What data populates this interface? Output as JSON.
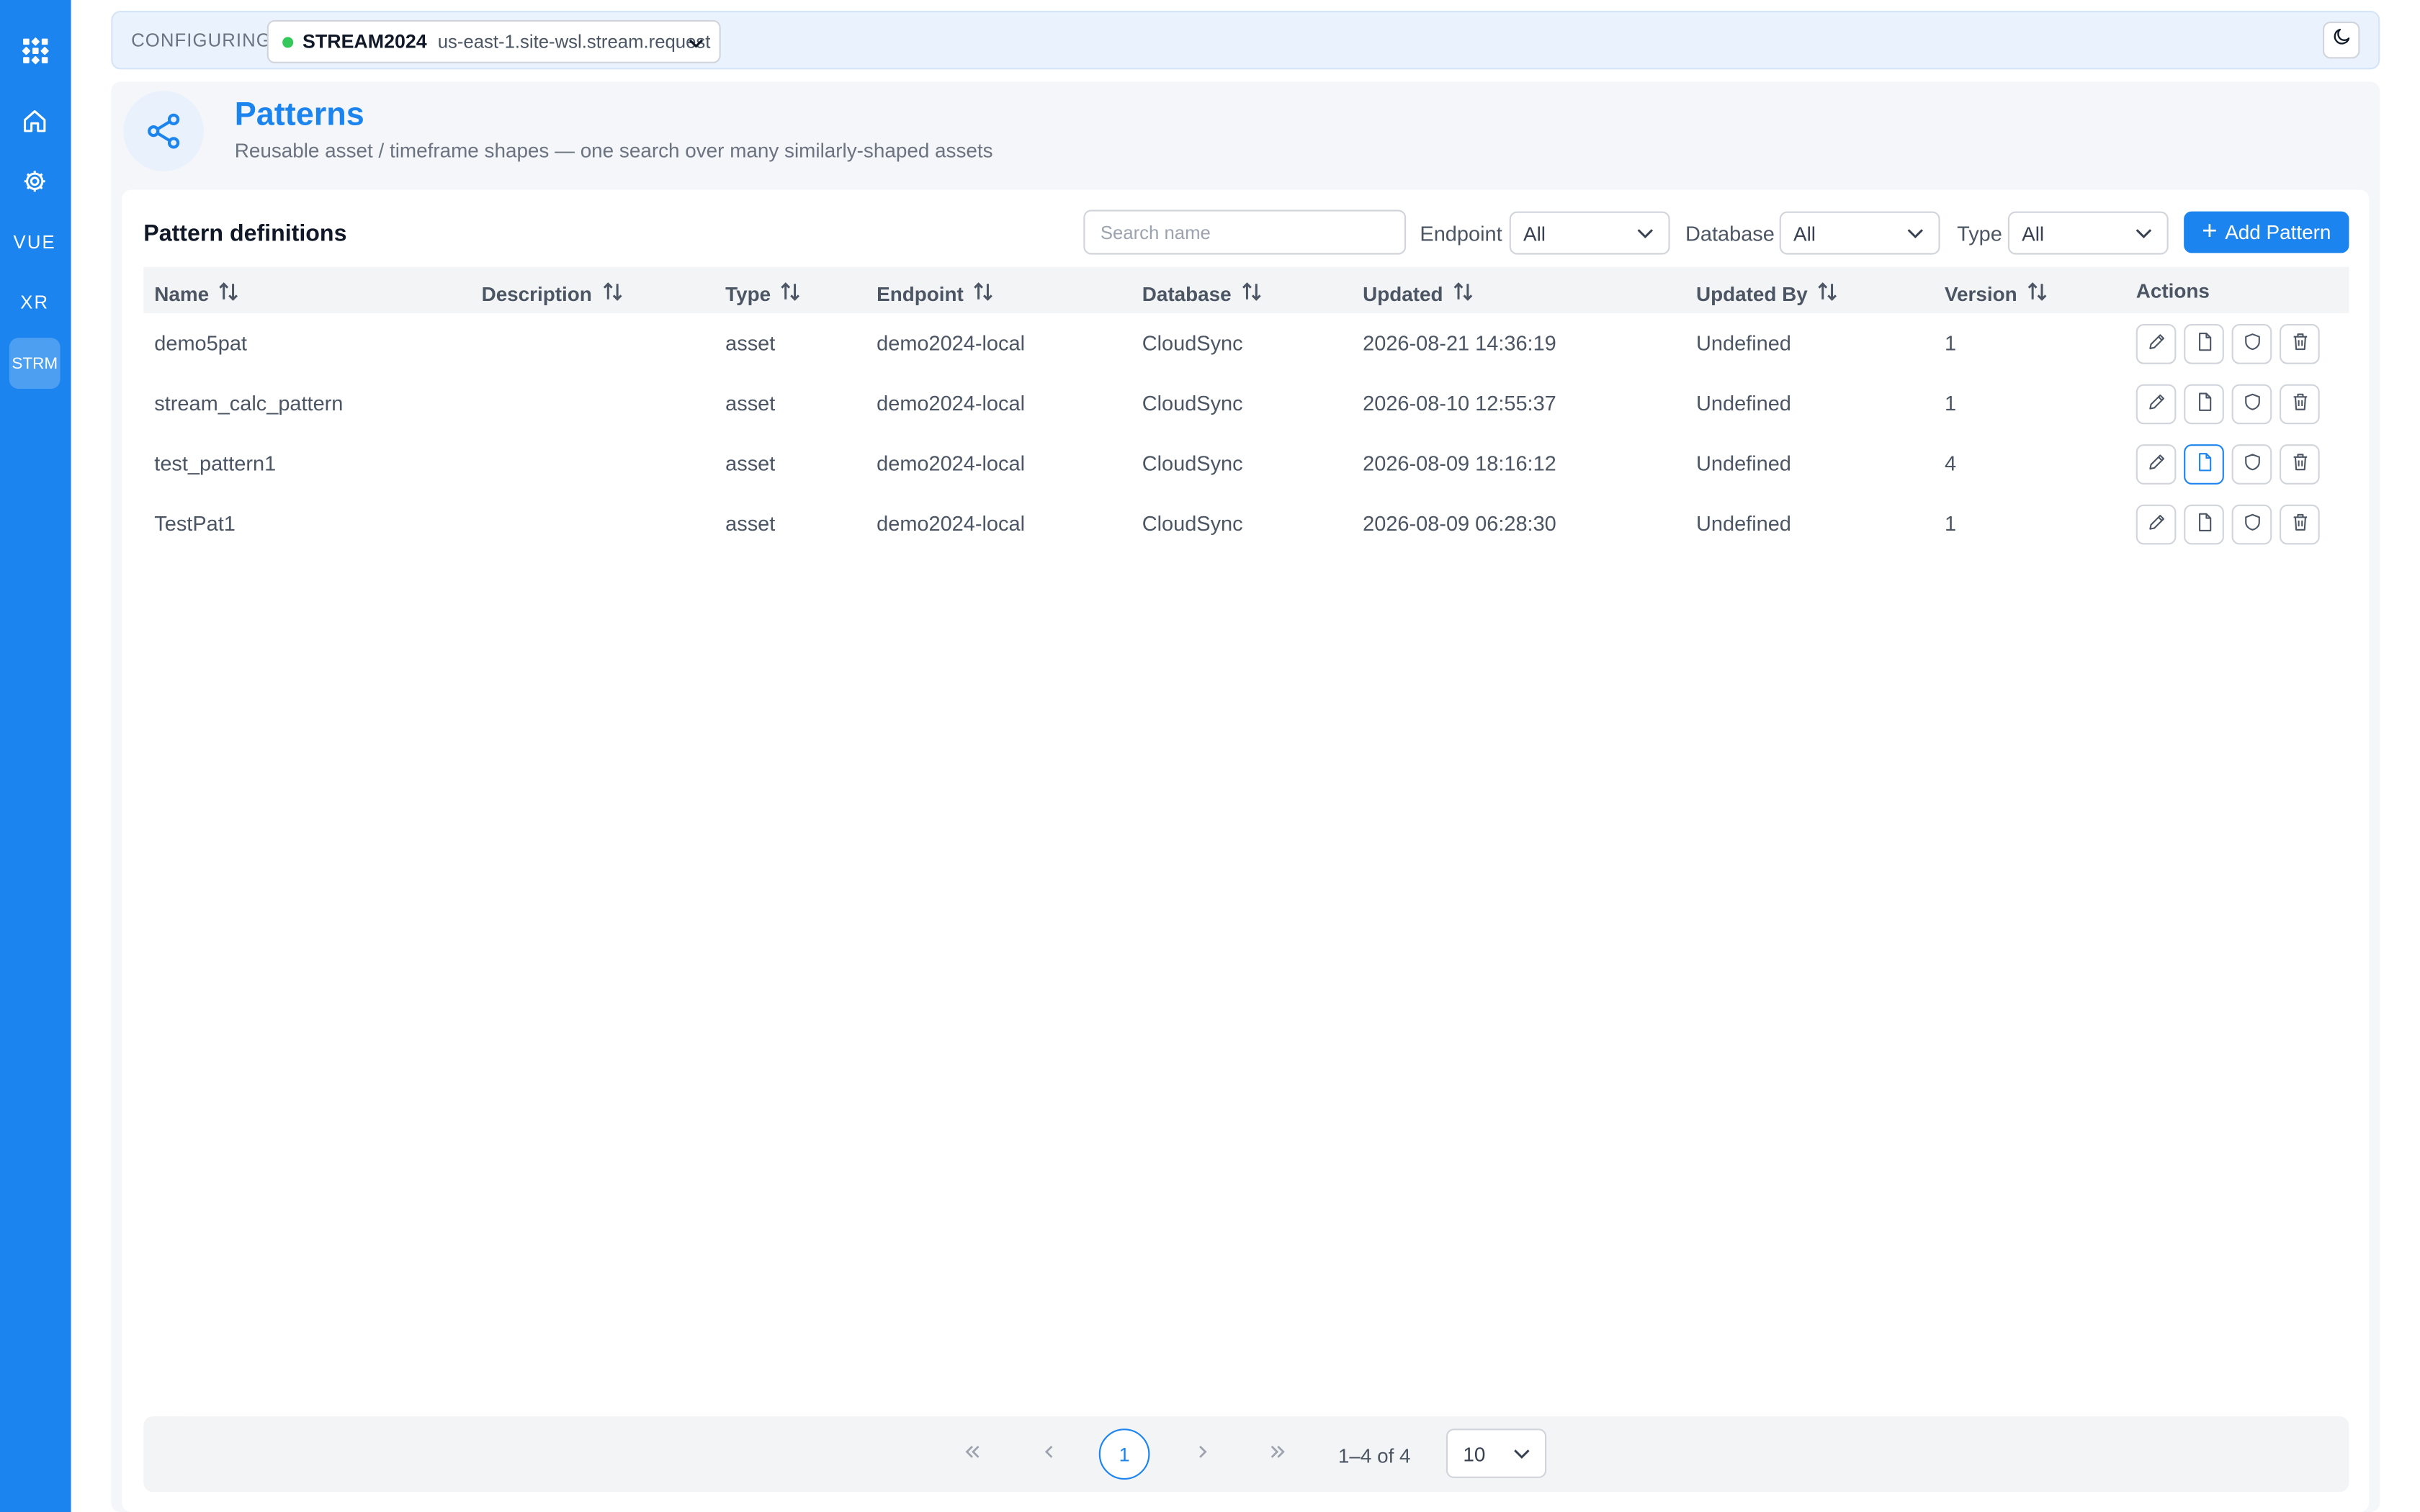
{
  "sidebar": {
    "items": [
      {
        "name": "logo",
        "icon": "grid-logo-icon"
      },
      {
        "name": "home",
        "icon": "home-icon"
      },
      {
        "name": "settings",
        "icon": "gear-icon"
      },
      {
        "name": "vue",
        "label": "VUE"
      },
      {
        "name": "xr",
        "label": "XR"
      },
      {
        "name": "strm",
        "label": "STRM",
        "active": true
      }
    ],
    "accent": "#1c84ee"
  },
  "topbar": {
    "configuring_label": "CONFIGURING",
    "endpoint_name": "STREAM2024",
    "endpoint_host": "us-east-1.site-wsl.stream.request",
    "status_color": "#34c759",
    "theme_icon": "moon-icon"
  },
  "header": {
    "title": "Patterns",
    "subtitle": "Reusable asset / timeframe shapes — one search over many similarly-shaped assets",
    "icon": "share-nodes-icon"
  },
  "card": {
    "title": "Pattern definitions",
    "search_placeholder": "Search name",
    "filters": {
      "endpoint_label": "Endpoint",
      "endpoint_value": "All",
      "database_label": "Database",
      "database_value": "All",
      "type_label": "Type",
      "type_value": "All"
    },
    "add_button": "Add Pattern"
  },
  "table": {
    "headers": {
      "name": "Name",
      "description": "Description",
      "type": "Type",
      "endpoint": "Endpoint",
      "database": "Database",
      "updated": "Updated",
      "updated_by": "Updated By",
      "version": "Version",
      "actions": "Actions"
    },
    "rows": [
      {
        "name": "demo5pat",
        "description": "",
        "type": "asset",
        "endpoint": "demo2024-local",
        "database": "CloudSync",
        "updated": "2026-08-21 14:36:19",
        "updated_by": "Undefined",
        "version": "1"
      },
      {
        "name": "stream_calc_pattern",
        "description": "",
        "type": "asset",
        "endpoint": "demo2024-local",
        "database": "CloudSync",
        "updated": "2026-08-10 12:55:37",
        "updated_by": "Undefined",
        "version": "1"
      },
      {
        "name": "test_pattern1",
        "description": "",
        "type": "asset",
        "endpoint": "demo2024-local",
        "database": "CloudSync",
        "updated": "2026-08-09 18:16:12",
        "updated_by": "Undefined",
        "version": "4"
      },
      {
        "name": "TestPat1",
        "description": "",
        "type": "asset",
        "endpoint": "demo2024-local",
        "database": "CloudSync",
        "updated": "2026-08-09 06:28:30",
        "updated_by": "Undefined",
        "version": "1"
      }
    ],
    "row_actions": [
      "pencil-icon",
      "file-icon",
      "shield-icon",
      "trash-icon"
    ]
  },
  "pagination": {
    "current_page": "1",
    "range_text": "1–4 of 4",
    "page_size": "10"
  }
}
